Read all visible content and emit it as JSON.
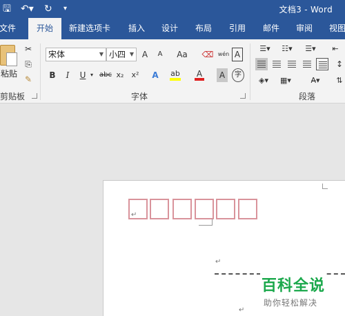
{
  "window": {
    "title": "文档3 - Word"
  },
  "quick_access": {
    "save_icon": "save-icon",
    "undo_icon": "undo-icon",
    "redo_icon": "redo-icon",
    "customize_icon": "customize-icon"
  },
  "tabs": [
    "文件",
    "开始",
    "新建选项卡",
    "插入",
    "设计",
    "布局",
    "引用",
    "邮件",
    "审阅",
    "视图"
  ],
  "active_tab": "开始",
  "clipboard": {
    "paste_label": "粘贴",
    "group_label": "剪贴板"
  },
  "font": {
    "name": "宋体",
    "size": "小四",
    "group_label": "字体",
    "grow": "A",
    "shrink": "A",
    "case": "Aa",
    "bold": "B",
    "italic": "I",
    "underline": "U",
    "strike": "abc",
    "subscript": "x₂",
    "superscript": "x²",
    "phonetic": "wén",
    "border_char": "A",
    "circle_char": "字"
  },
  "paragraph": {
    "group_label": "段落"
  },
  "document": {
    "grid_box_count": 6,
    "paragraph_mark": "↵"
  },
  "watermark": {
    "title": "百科全说",
    "subtitle": "助你轻松解决"
  },
  "colors": {
    "titlebar": "#2b579a",
    "ribbon": "#f3f3f3",
    "grid_border": "#d9939b",
    "highlight_yellow": "#ffff00",
    "font_red": "#e02020",
    "watermark_green": "#1aa84b"
  }
}
